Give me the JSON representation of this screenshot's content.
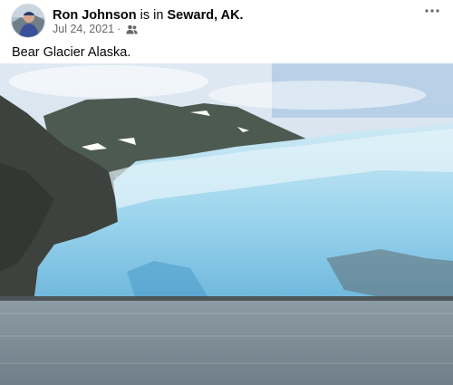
{
  "post": {
    "author": "Ron Johnson",
    "is_in": "is in",
    "location": "Seward, AK.",
    "date": "Jul 24, 2021",
    "separator": "·",
    "audience_icon": "friends-icon",
    "more_icon": "ellipsis-icon",
    "caption": "Bear Glacier Alaska."
  },
  "colors": {
    "text_primary": "#050505",
    "text_secondary": "#65676b",
    "glacier_ice": "#8fd0ea",
    "water": "#7d8c96"
  }
}
